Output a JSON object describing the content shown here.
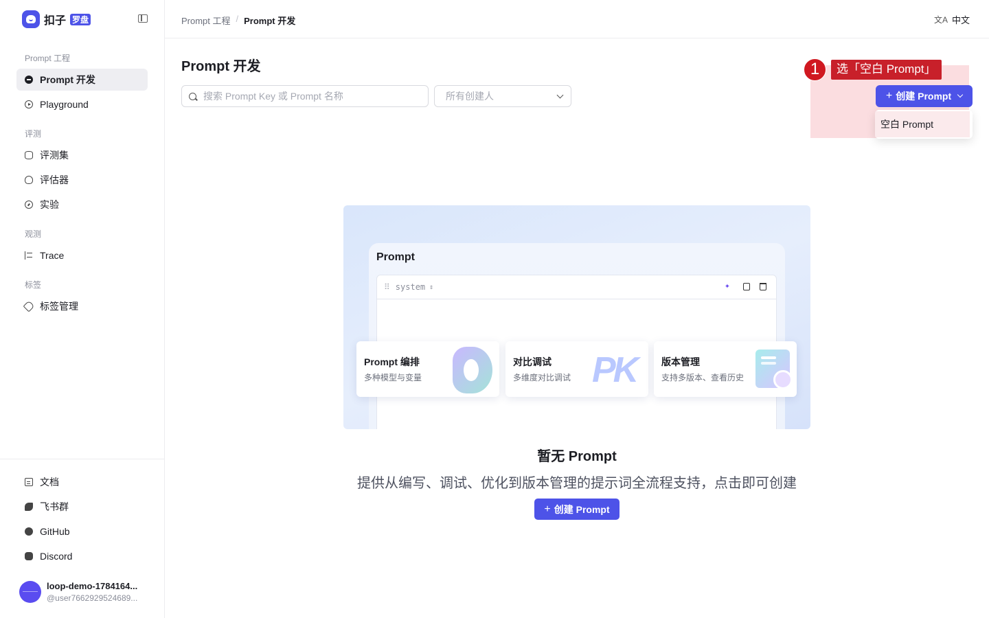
{
  "brand": {
    "name": "扣子",
    "tag": "罗盘"
  },
  "sidebar": {
    "groups": [
      {
        "label": "Prompt 工程"
      },
      {
        "label": "评测"
      },
      {
        "label": "观测"
      },
      {
        "label": "标签"
      }
    ],
    "items": [
      {
        "label": "Prompt 开发",
        "icon": "chat-bubble-icon",
        "active": true
      },
      {
        "label": "Playground",
        "icon": "play-circle-icon"
      },
      {
        "label": "评测集",
        "icon": "database-icon"
      },
      {
        "label": "评估器",
        "icon": "bulb-icon"
      },
      {
        "label": "实验",
        "icon": "gauge-icon"
      },
      {
        "label": "Trace",
        "icon": "trace-icon"
      },
      {
        "label": "标签管理",
        "icon": "tag-icon"
      }
    ],
    "bottom_items": [
      {
        "label": "文档",
        "icon": "document-icon"
      },
      {
        "label": "飞书群",
        "icon": "feishu-icon"
      },
      {
        "label": "GitHub",
        "icon": "github-icon"
      },
      {
        "label": "Discord",
        "icon": "discord-icon"
      }
    ],
    "user": {
      "name": "loop-demo-1784164...",
      "handle": "@user7662929524689..."
    }
  },
  "header": {
    "breadcrumb": [
      "Prompt 工程",
      "Prompt 开发"
    ],
    "language": "中文",
    "language_icon": "文A"
  },
  "main": {
    "title": "Prompt 开发",
    "search_placeholder": "搜索 Prompt Key 或 Prompt 名称",
    "creator_filter": "所有创建人",
    "create_button": "创建 Prompt",
    "dropdown_item": "空白 Prompt",
    "annotation": {
      "step": "1",
      "text": "选「空白 Prompt」"
    }
  },
  "illustration": {
    "title": "Prompt",
    "role": "system",
    "features": [
      {
        "title": "Prompt 编排",
        "desc": "多种模型与变量"
      },
      {
        "title": "对比调试",
        "desc": "多维度对比调试",
        "art": "PK"
      },
      {
        "title": "版本管理",
        "desc": "支持多版本、查看历史"
      }
    ]
  },
  "empty_state": {
    "title": "暂无 Prompt",
    "description": "提供从编写、调试、优化到版本管理的提示词全流程支持，点击即可创建",
    "button": "创建 Prompt"
  },
  "colors": {
    "primary": "#4d53e8",
    "annotation": "#c8202a"
  }
}
